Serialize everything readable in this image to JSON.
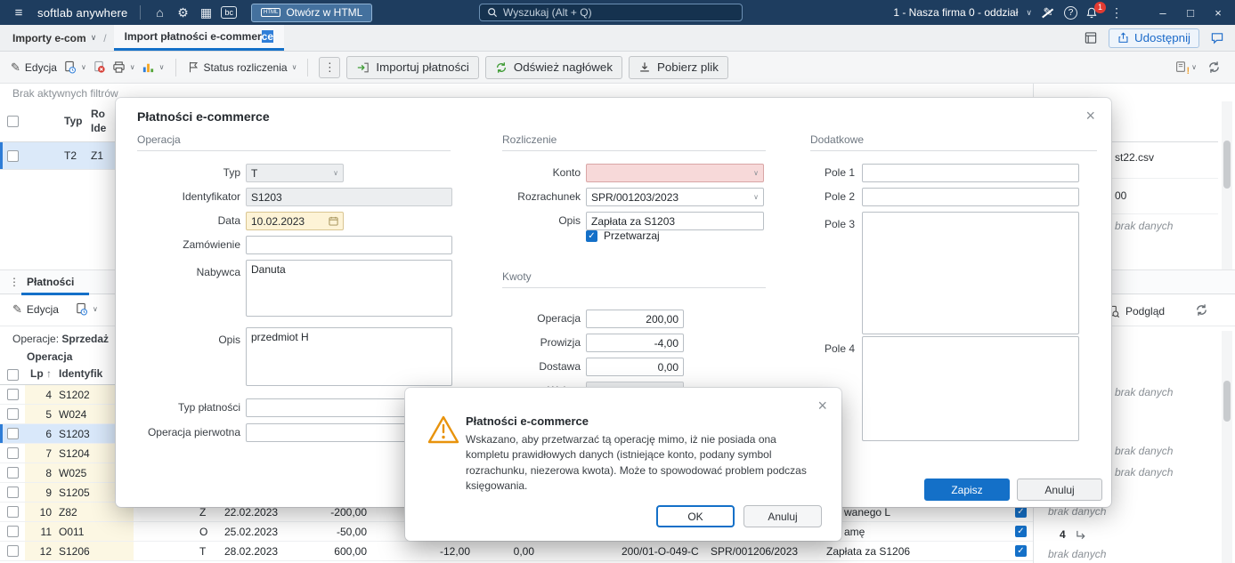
{
  "topbar": {
    "app_name": "softlab anywhere",
    "open_in_html": "Otwórz w HTML",
    "html_badge": "HTML",
    "bc_badge": "bc",
    "search_placeholder": "Wyszukaj (Alt + Q)",
    "company_selector": "1 - Nasza firma 0 - oddział",
    "notification_badge": "1"
  },
  "tabbar": {
    "breadcrumb": "Importy e-com",
    "path_separator": "/",
    "tab_title": "Import płatności e-commer",
    "tab_title_selection": "ce",
    "share_button": "Udostępnij"
  },
  "toolbar": {
    "edit": "Edycja",
    "status_filter": "Status rozliczenia",
    "import_payments": "Importuj płatności",
    "refresh_header": "Odśwież nagłówek",
    "download_file": "Pobierz plik"
  },
  "filters_note": "Brak aktywnych filtrów",
  "upper_grid": {
    "col_typ": "Typ",
    "col_second_line1": "Ro",
    "col_second_line2": "Ide",
    "row_typ": "T2",
    "row_id": "Z1",
    "file_name": "st22.csv",
    "amount_fragment": "00"
  },
  "payments": {
    "tab_title": "Płatności",
    "edit": "Edycja",
    "operations_label": "Operacje:",
    "operations_value": "Sprzedaż",
    "preview_button": "Podgląd",
    "group_header": "Operacja",
    "col_lp": "Lp",
    "sort_indicator": "↑",
    "col_identifier": "Identyfik",
    "rows": [
      {
        "lp": "4",
        "id": "S1202"
      },
      {
        "lp": "5",
        "id": "W024"
      },
      {
        "lp": "6",
        "id": "S1203"
      },
      {
        "lp": "7",
        "id": "S1204"
      },
      {
        "lp": "8",
        "id": "W025"
      },
      {
        "lp": "9",
        "id": "S1205"
      },
      {
        "lp": "10",
        "id": "Z82",
        "typ": "Z",
        "data": "22.02.2023",
        "kwota": "-200,00",
        "opis_fragment": "wanego L"
      },
      {
        "lp": "11",
        "id": "O011",
        "typ": "O",
        "data": "25.02.2023",
        "kwota": "-50,00",
        "opis_fragment": "amę"
      },
      {
        "lp": "12",
        "id": "S1206",
        "typ": "T",
        "data": "28.02.2023",
        "kwota": "600,00",
        "prowizja": "-12,00",
        "dostawa": "0,00",
        "konto": "200/01-O-049-C",
        "rozrachunek": "SPR/001206/2023",
        "opis": "Zapłata za S1206"
      }
    ]
  },
  "side_panel": {
    "no_data": "brak danych",
    "record_count": "4"
  },
  "modal": {
    "title": "Płatności e-commerce",
    "section_operation": "Operacja",
    "section_settlement": "Rozliczenie",
    "section_additional": "Dodatkowe",
    "section_amounts": "Kwoty",
    "typ_label": "Typ",
    "typ_value": "T",
    "identifier_label": "Identyfikator",
    "identifier_value": "S1203",
    "date_label": "Data",
    "date_value": "10.02.2023",
    "order_label": "Zamówienie",
    "order_value": "",
    "buyer_label": "Nabywca",
    "buyer_value": "Danuta",
    "description_label": "Opis",
    "description_value": "przedmiot H",
    "payment_type_label": "Typ płatności",
    "payment_type_value": "",
    "original_operation_label": "Operacja pierwotna",
    "original_operation_value": "",
    "account_label": "Konto",
    "account_value": "",
    "settlement_label": "Rozrachunek",
    "settlement_value": "SPR/001203/2023",
    "settlement_desc_label": "Opis",
    "settlement_desc_value": "Zapłata za S1203",
    "process_label": "Przetwarzaj",
    "amount_operation_label": "Operacja",
    "amount_operation_value": "200,00",
    "commission_label": "Prowizja",
    "commission_value": "-4,00",
    "delivery_label": "Dostawa",
    "delivery_value": "0,00",
    "currency_label": "Waluta",
    "currency_value": "",
    "field1_label": "Pole 1",
    "field1_value": "",
    "field2_label": "Pole 2",
    "field2_value": "",
    "field3_label": "Pole 3",
    "field3_value": "",
    "field4_label": "Pole 4",
    "field4_value": "",
    "save_button": "Zapisz",
    "cancel_button": "Anuluj"
  },
  "alert": {
    "title": "Płatności e-commerce",
    "message": "Wskazano, aby przetwarzać tą operację mimo, iż nie posiada ona kompletu prawidłowych danych (istniejące konto, podany symbol rozrachunku, niezerowa kwota). Może to spowodować problem podczas księgowania.",
    "ok_button": "OK",
    "cancel_button": "Anuluj"
  }
}
